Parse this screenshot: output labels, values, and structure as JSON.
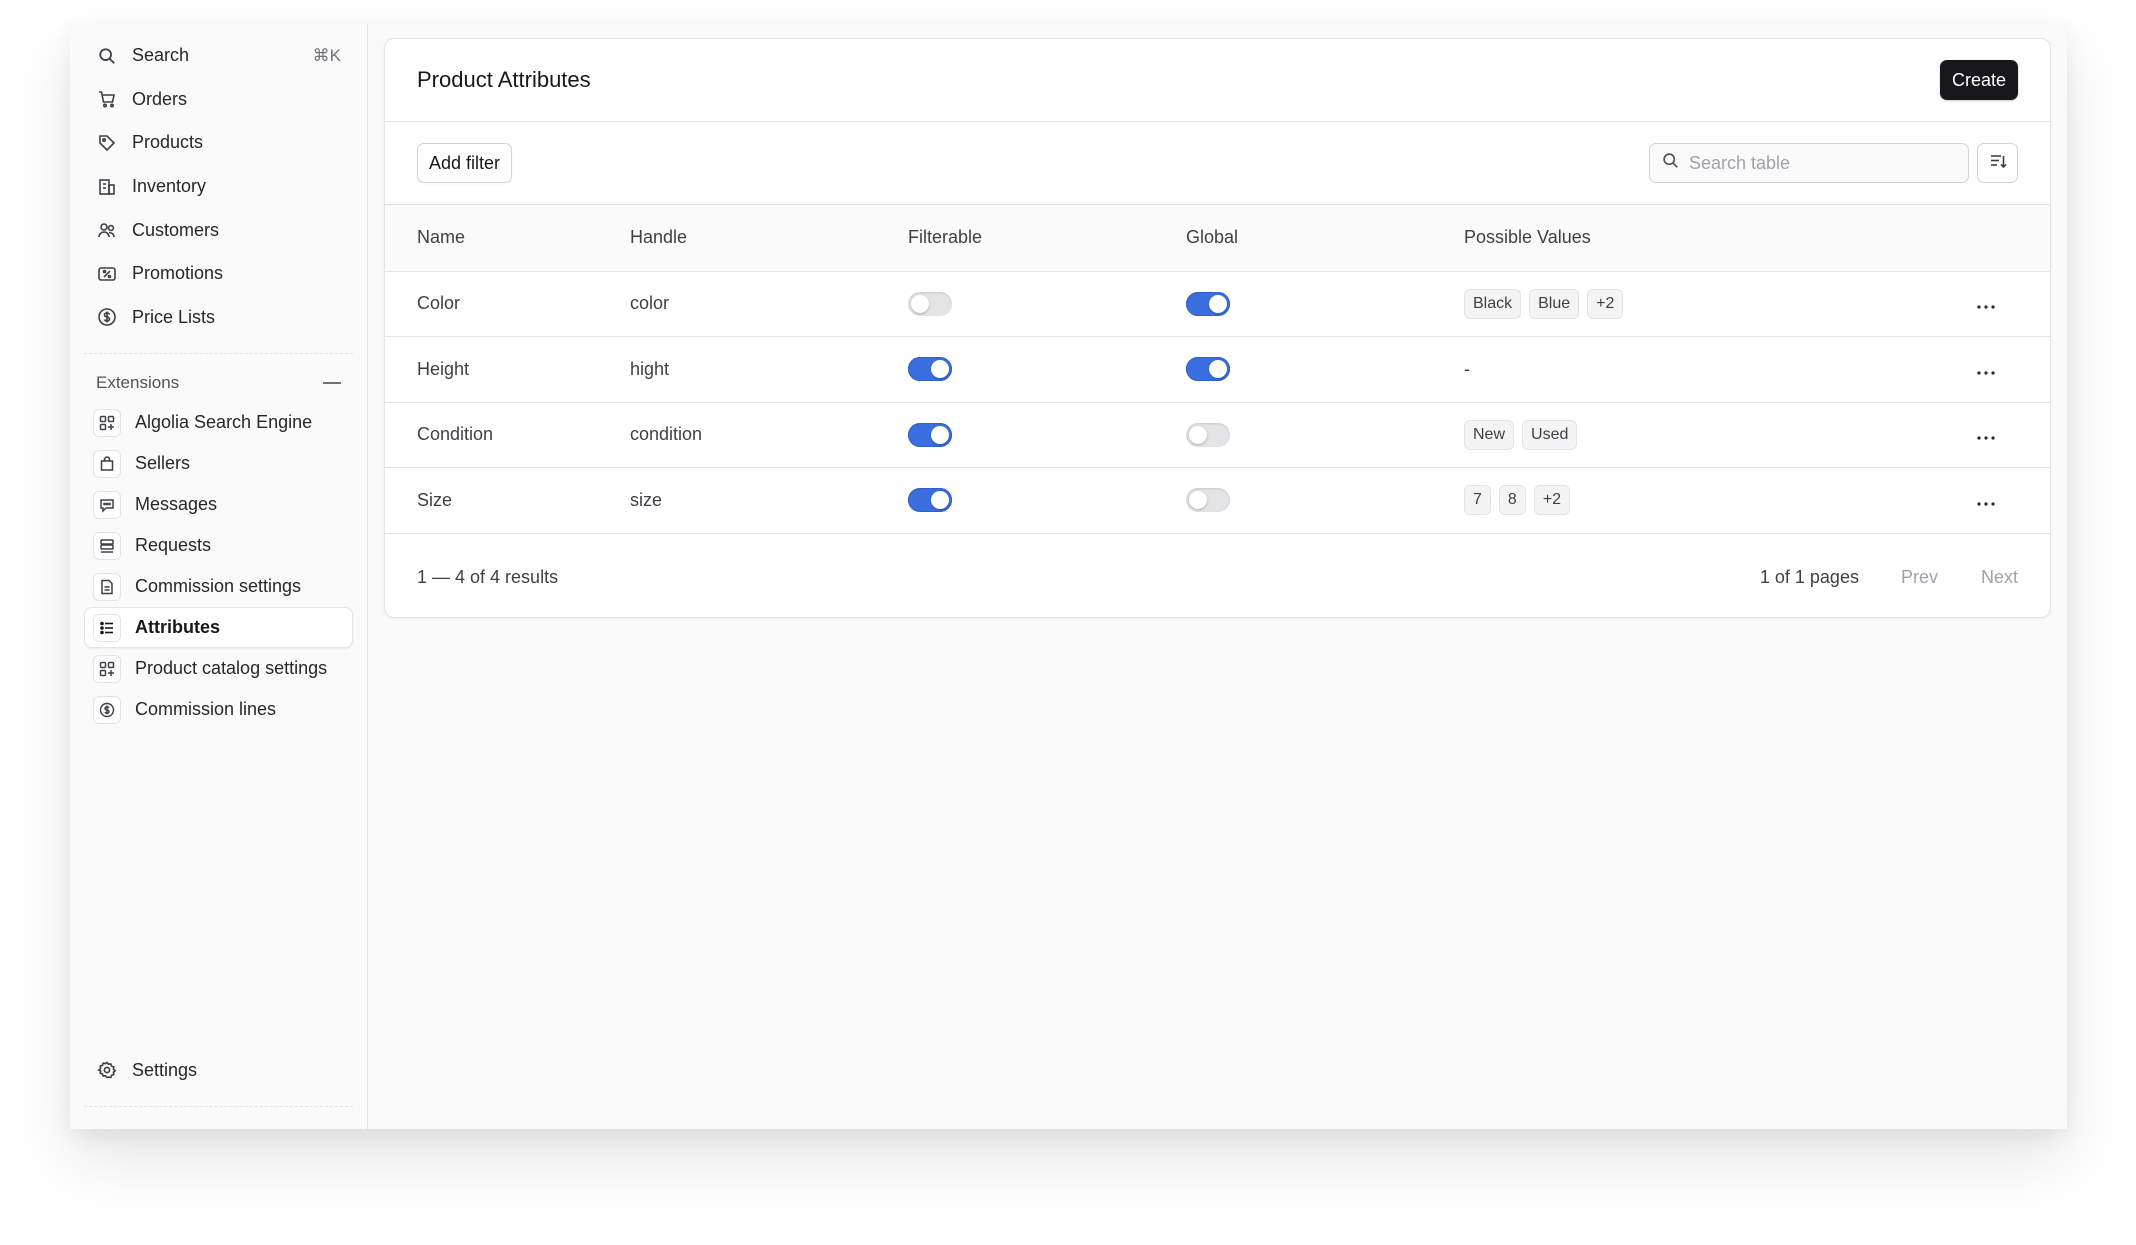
{
  "sidebar": {
    "search": {
      "label": "Search",
      "shortcut": "⌘K"
    },
    "items": [
      {
        "label": "Orders",
        "icon": "cart-icon"
      },
      {
        "label": "Products",
        "icon": "tag-icon"
      },
      {
        "label": "Inventory",
        "icon": "buildings-icon"
      },
      {
        "label": "Customers",
        "icon": "users-icon"
      },
      {
        "label": "Promotions",
        "icon": "receipt-percent-icon"
      },
      {
        "label": "Price Lists",
        "icon": "currency-dollar-icon"
      }
    ],
    "extensions_label": "Extensions",
    "extensions": [
      {
        "label": "Algolia Search Engine",
        "icon": "squares-plus-icon"
      },
      {
        "label": "Sellers",
        "icon": "shopping-bag-icon"
      },
      {
        "label": "Messages",
        "icon": "chat-bubble-icon"
      },
      {
        "label": "Requests",
        "icon": "server-stack-icon"
      },
      {
        "label": "Commission settings",
        "icon": "document-icon"
      },
      {
        "label": "Attributes",
        "icon": "list-bullet-icon",
        "active": true
      },
      {
        "label": "Product catalog settings",
        "icon": "squares-plus-icon"
      },
      {
        "label": "Commission lines",
        "icon": "currency-dollar-icon"
      }
    ],
    "settings_label": "Settings"
  },
  "card": {
    "title": "Product Attributes",
    "create_label": "Create"
  },
  "toolbar": {
    "add_filter_label": "Add filter",
    "search_placeholder": "Search table"
  },
  "table": {
    "headers": [
      "Name",
      "Handle",
      "Filterable",
      "Global",
      "Possible Values"
    ],
    "rows": [
      {
        "name": "Color",
        "handle": "color",
        "filterable": false,
        "global": true,
        "values": [
          "Black",
          "Blue",
          "+2"
        ]
      },
      {
        "name": "Height",
        "handle": "hight",
        "filterable": true,
        "global": true,
        "values": [],
        "empty_text": "-"
      },
      {
        "name": "Condition",
        "handle": "condition",
        "filterable": true,
        "global": false,
        "values": [
          "New",
          "Used"
        ]
      },
      {
        "name": "Size",
        "handle": "size",
        "filterable": true,
        "global": false,
        "values": [
          "7",
          "8",
          "+2"
        ]
      }
    ]
  },
  "pagination": {
    "results": "1 — 4 of 4 results",
    "pages": "1 of 1 pages",
    "prev": "Prev",
    "next": "Next"
  },
  "colors": {
    "accent": "#3b6fe0",
    "primary_button": "#18181b"
  }
}
